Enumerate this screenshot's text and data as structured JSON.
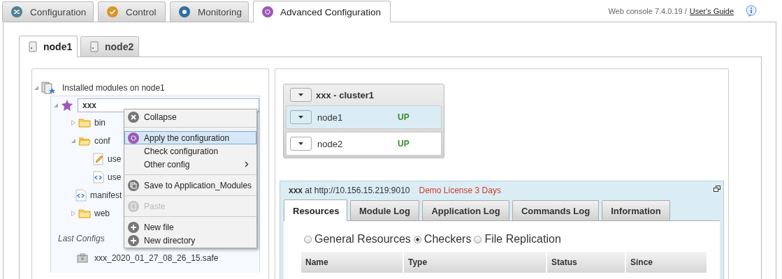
{
  "top_tabs": [
    {
      "label": "Configuration",
      "kind": "shuffle",
      "selected": false
    },
    {
      "label": "Control",
      "kind": "check",
      "selected": false
    },
    {
      "label": "Monitoring",
      "kind": "record",
      "selected": false
    },
    {
      "label": "Advanced Configuration",
      "kind": "gear",
      "selected": true
    }
  ],
  "header": {
    "version": "Web console 7.4.0.19 /",
    "guide_link": "User's Guide"
  },
  "node_tabs": [
    {
      "label": "node1",
      "selected": true
    },
    {
      "label": "node2",
      "selected": false
    }
  ],
  "tree": {
    "label": "Installed modules on node1",
    "expanded": true,
    "children": [
      {
        "label": "xxx",
        "kind": "module",
        "expanded": true,
        "selected": true,
        "children": [
          {
            "label": "bin",
            "kind": "folder",
            "expanded": false
          },
          {
            "label": "conf",
            "kind": "folder",
            "expanded": true,
            "children": [
              {
                "label": "use",
                "kind": "edit"
              },
              {
                "label": "use",
                "kind": "code"
              }
            ]
          },
          {
            "label": "manifest",
            "kind": "code"
          },
          {
            "label": "web",
            "kind": "folder",
            "expanded": false
          }
        ]
      }
    ]
  },
  "last_configs": {
    "title": "Last Configs",
    "items": [
      "xxx_2020_01_27_08_26_15.safe"
    ]
  },
  "context_menu": {
    "groups": [
      [
        {
          "label": "Collapse",
          "kind": "close",
          "selected": false,
          "disabled": false,
          "submenu": false
        }
      ],
      [
        {
          "label": "Apply the configuration",
          "kind": "gear",
          "selected": true,
          "disabled": false,
          "submenu": false
        },
        {
          "label": "Check configuration",
          "kind": "none",
          "selected": false,
          "disabled": false,
          "submenu": false
        },
        {
          "label": "Other config",
          "kind": "none",
          "selected": false,
          "disabled": false,
          "submenu": true
        }
      ],
      [
        {
          "label": "Save to Application_Modules",
          "kind": "copy",
          "selected": false,
          "disabled": false,
          "submenu": false
        }
      ],
      [
        {
          "label": "Paste",
          "kind": "paste",
          "selected": false,
          "disabled": true,
          "submenu": false
        }
      ],
      [
        {
          "label": "New file",
          "kind": "plus",
          "selected": false,
          "disabled": false,
          "submenu": false
        },
        {
          "label": "New directory",
          "kind": "plus",
          "selected": false,
          "disabled": false,
          "submenu": false
        }
      ]
    ]
  },
  "cluster": {
    "title": "xxx - cluster1",
    "nodes": [
      {
        "name": "node1",
        "status": "UP",
        "selected": true
      },
      {
        "name": "node2",
        "status": "UP",
        "selected": false
      }
    ]
  },
  "resource_panel": {
    "title": "**xxx** at http://10.156.15.219:9010",
    "license": "Demo License 3 Days",
    "tabs": [
      {
        "label": "Resources",
        "selected": true
      },
      {
        "label": "Module Log",
        "selected": false
      },
      {
        "label": "Application Log",
        "selected": false
      },
      {
        "label": "Commands Log",
        "selected": false
      },
      {
        "label": "Information",
        "selected": false
      }
    ],
    "radios": [
      {
        "label": "General Resources",
        "selected": false
      },
      {
        "label": "Checkers",
        "selected": true
      },
      {
        "label": "File Replication",
        "selected": false
      }
    ],
    "columns": [
      "Name",
      "Type",
      "Status",
      "Since"
    ]
  }
}
